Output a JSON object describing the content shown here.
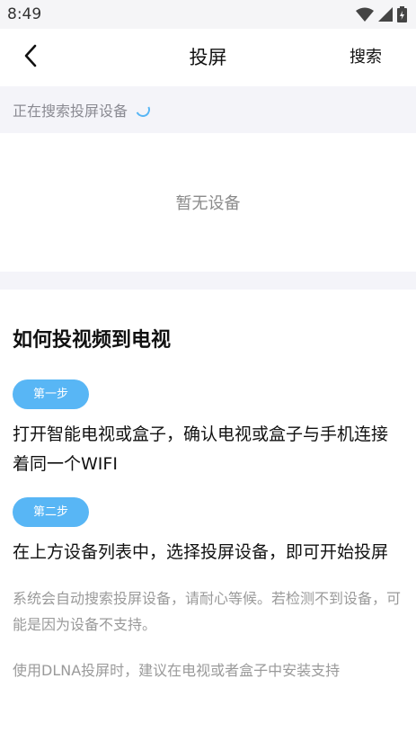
{
  "status_bar": {
    "time": "8:49",
    "icons": [
      "wifi-icon",
      "signal-icon",
      "battery-icon"
    ]
  },
  "app_bar": {
    "back_icon": "chevron-left-icon",
    "title": "投屏",
    "search_label": "搜索"
  },
  "search_status": {
    "text": "正在搜索投屏设备",
    "spinner_color": "#58b6f5"
  },
  "device_list": {
    "empty_text": "暂无设备"
  },
  "guide": {
    "title": "如何投视频到电视",
    "step1_label": "第一步",
    "step1_text": "打开智能电视或盒子，确认电视或盒子与手机连接着同一个WIFI",
    "step2_label": "第二步",
    "step2_text": "在上方设备列表中，选择投屏设备，即可开始投屏",
    "note1": "系统会自动搜索投屏设备，请耐心等候。若检测不到设备，可能是因为设备不支持。",
    "note2": "使用DLNA投屏时，建议在电视或者盒子中安装支持"
  },
  "colors": {
    "accent": "#58b6f5",
    "section_bg": "#f4f4f9"
  }
}
